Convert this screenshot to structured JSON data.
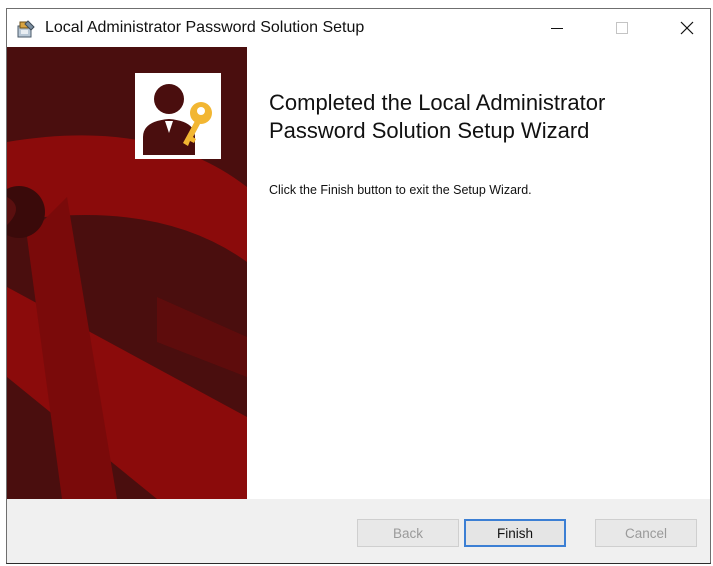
{
  "window": {
    "title": "Local Administrator Password Solution Setup",
    "controls": {
      "minimize": "minimize-icon",
      "maximize": "maximize-icon",
      "close": "close-icon"
    }
  },
  "content": {
    "heading": "Completed the Local Administrator Password Solution Setup Wizard",
    "body": "Click the Finish button to exit the Setup Wizard."
  },
  "buttons": {
    "back": {
      "label": "Back",
      "enabled": false
    },
    "finish": {
      "label": "Finish",
      "enabled": true,
      "default": true
    },
    "cancel": {
      "label": "Cancel",
      "enabled": false
    }
  },
  "colors": {
    "banner_dark": "#4a0e0e",
    "banner_red": "#8b0b0b",
    "key_gold": "#f2b632",
    "default_button_border": "#3c7fd4"
  },
  "icons": [
    "installer-icon",
    "admin-key-logo-icon"
  ]
}
